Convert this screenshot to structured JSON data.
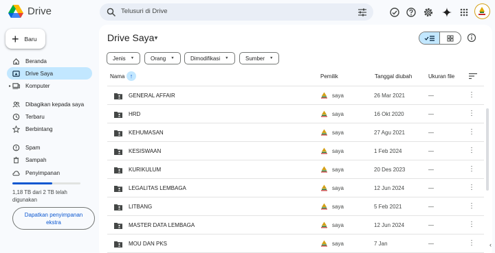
{
  "app": {
    "name": "Drive"
  },
  "search": {
    "placeholder": "Telusuri di Drive"
  },
  "sidebar": {
    "new_label": "Baru",
    "items": [
      {
        "label": "Beranda"
      },
      {
        "label": "Drive Saya"
      },
      {
        "label": "Komputer"
      },
      {
        "label": "Dibagikan kepada saya"
      },
      {
        "label": "Terbaru"
      },
      {
        "label": "Berbintang"
      },
      {
        "label": "Spam"
      },
      {
        "label": "Sampah"
      },
      {
        "label": "Penyimpanan"
      }
    ],
    "storage": {
      "text": "1,18 TB dari 2 TB telah digunakan",
      "used_fraction": 0.59
    },
    "get_storage": "Dapatkan penyimpanan ekstra"
  },
  "main": {
    "title": "Drive Saya",
    "filters": [
      "Jenis",
      "Orang",
      "Dimodifikasi",
      "Sumber"
    ],
    "columns": {
      "name": "Nama",
      "owner": "Pemilik",
      "date": "Tanggal diubah",
      "size": "Ukuran file"
    },
    "rows": [
      {
        "name": "GENERAL AFFAIR",
        "owner": "saya",
        "date": "26 Mar 2021",
        "size": "—"
      },
      {
        "name": "HRD",
        "owner": "saya",
        "date": "16 Okt 2020",
        "size": "—"
      },
      {
        "name": "KEHUMASAN",
        "owner": "saya",
        "date": "27 Agu 2021",
        "size": "—"
      },
      {
        "name": "KESISWAAN",
        "owner": "saya",
        "date": "1 Feb 2024",
        "size": "—"
      },
      {
        "name": "KURIKULUM",
        "owner": "saya",
        "date": "20 Des 2023",
        "size": "—"
      },
      {
        "name": "LEGALITAS LEMBAGA",
        "owner": "saya",
        "date": "12 Jun 2024",
        "size": "—"
      },
      {
        "name": "LITBANG",
        "owner": "saya",
        "date": "5 Feb 2021",
        "size": "—"
      },
      {
        "name": "MASTER DATA LEMBAGA",
        "owner": "saya",
        "date": "12 Jun 2024",
        "size": "—"
      },
      {
        "name": "MOU DAN PKS",
        "owner": "saya",
        "date": "7 Jan",
        "size": "—"
      }
    ]
  },
  "colors": {
    "accent": "#0b57d0",
    "active_bg": "#c2e7ff",
    "background": "#f8fafd"
  }
}
